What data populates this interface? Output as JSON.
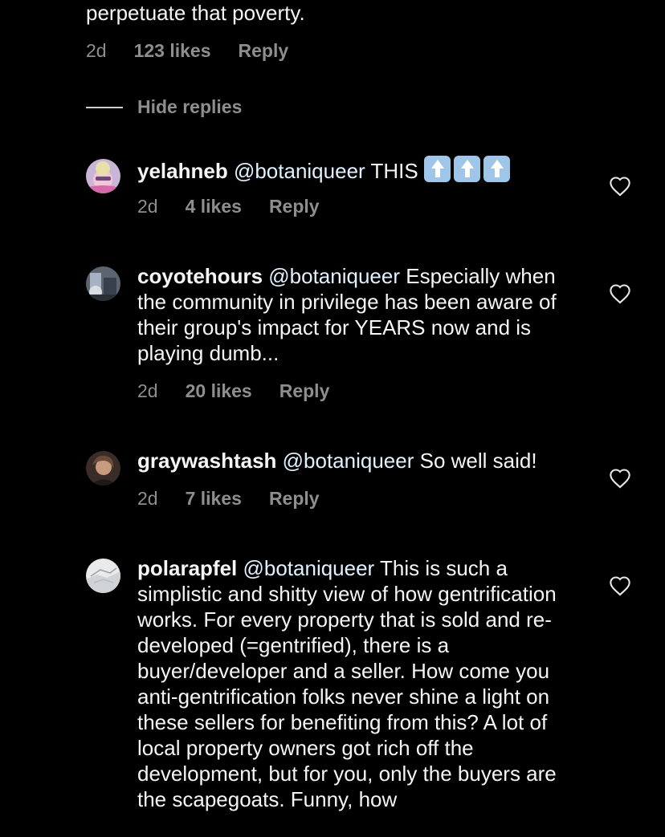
{
  "previous_comment": {
    "text_tail": "perpetuate that poverty.",
    "time": "2d",
    "likes": "123 likes",
    "reply": "Reply"
  },
  "hide_replies": "Hide replies",
  "replies": [
    {
      "username": "yelahneb",
      "mention": "@botaniqueer",
      "text": "THIS",
      "emoji": "up-arrow-emoji x3",
      "time": "2d",
      "likes": "4 likes",
      "reply": "Reply"
    },
    {
      "username": "coyotehours",
      "mention": "@botaniqueer",
      "text": "Especially when the community in privilege has been aware of their group's impact for YEARS now and is playing dumb...",
      "time": "2d",
      "likes": "20 likes",
      "reply": "Reply"
    },
    {
      "username": "graywashtash",
      "mention": "@botaniqueer",
      "text": "So well said!",
      "time": "2d",
      "likes": "7 likes",
      "reply": "Reply"
    },
    {
      "username": "polarapfel",
      "mention": "@botaniqueer",
      "text": "This is such a simplistic and shitty view of how gentrification works. For every property that is sold and re-developed (=gentrified), there is a buyer/developer and a seller. How come you anti-gentrification folks never shine a light on these sellers for benefiting from this? A lot of local property owners got rich off the development, but for you, only the buyers are the scapegoats. Funny, how"
    }
  ],
  "colors": {
    "background": "#000000",
    "primary_text": "#f5f5f5",
    "secondary_text": "#8e8e8e",
    "emoji_bg": "#9fc6e8"
  },
  "icons": [
    "heart-outline-icon",
    "up-arrow-emoji"
  ]
}
